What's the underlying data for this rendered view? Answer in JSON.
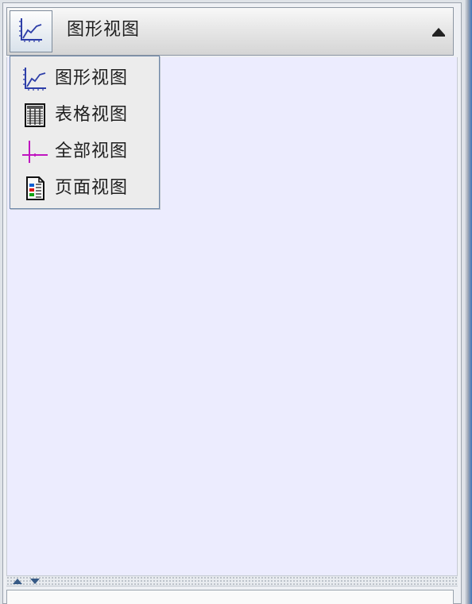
{
  "viewbar": {
    "current_view_label": "图形视图",
    "icon": "line-chart-icon",
    "toggle_icon": "chevron-up-icon"
  },
  "dropdown": {
    "items": [
      {
        "label": "图形视图",
        "icon": "line-chart-icon"
      },
      {
        "label": "表格视图",
        "icon": "table-icon"
      },
      {
        "label": "全部视图",
        "icon": "crosshair-icon"
      },
      {
        "label": "页面视图",
        "icon": "page-icon"
      }
    ]
  },
  "splitter": {
    "up_icon": "chevron-up-icon",
    "down_icon": "chevron-down-icon"
  },
  "colors": {
    "content_background": "#ececfe",
    "menu_background": "#ececec",
    "menu_border": "#6d87a8",
    "text": "#1f1f1f",
    "chart_icon": "#2d3ea8",
    "crosshair_icon": "#c015c0"
  }
}
